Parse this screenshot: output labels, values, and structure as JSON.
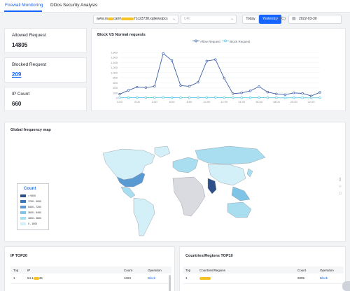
{
  "tabs": [
    {
      "label": "Firewall Monitoring",
      "active": true
    },
    {
      "label": "DDos Security Analysis",
      "active": false
    }
  ],
  "toolbar": {
    "domain_prefix": "www.rs",
    "domain_mid": "cam/",
    "domain_suffix": "71c23738.xgliewsipcs",
    "url_placeholder": "URI",
    "today_label": "Today",
    "yesterday_label": "Yesterday",
    "timezone_label": "(UTC)",
    "date_value": "2022-03-30",
    "colors": {
      "primary": "#1664ff"
    }
  },
  "stats": {
    "allowed_label": "Allowed Request",
    "allowed_value": "14805",
    "blocked_label": "Blocked Request",
    "blocked_value": "209",
    "ip_label": "IP Count",
    "ip_value": "660"
  },
  "chart_data": {
    "type": "line",
    "title": "Block VS Normal requests",
    "x": [
      "0:00",
      "1:00",
      "2:00",
      "3:00",
      "4:00",
      "5:00",
      "6:00",
      "7:00",
      "8:00",
      "9:00",
      "10:00",
      "11:00",
      "12:00",
      "13:00",
      "14:00",
      "15:00",
      "16:00",
      "17:00",
      "18:00",
      "19:00",
      "20:00",
      "21:00",
      "22:00",
      "23:00"
    ],
    "x_tick_labels": [
      "0:00",
      "2:00",
      "4:00",
      "6:00",
      "8:00",
      "10:00",
      "12:00",
      "14:00",
      "16:00",
      "18:00",
      "20:00",
      "22:00"
    ],
    "y_tick_labels": [
      "0",
      "200",
      "400",
      "600",
      "800",
      "1,000",
      "1,200",
      "1,400",
      "1,600",
      "1,800"
    ],
    "ylim": [
      0,
      1800
    ],
    "series": [
      {
        "name": "Allow Request",
        "color": "#3f5fa8",
        "values": [
          150,
          300,
          430,
          410,
          460,
          1760,
          1480,
          490,
          460,
          620,
          1460,
          1520,
          780,
          170,
          200,
          280,
          450,
          230,
          160,
          130,
          200,
          180,
          80,
          220
        ]
      },
      {
        "name": "Block Request",
        "color": "#5ec9e6",
        "values": [
          10,
          12,
          15,
          12,
          18,
          20,
          14,
          10,
          12,
          15,
          18,
          20,
          12,
          8,
          8,
          10,
          12,
          9,
          8,
          6,
          8,
          7,
          6,
          9
        ]
      }
    ],
    "legend_position": "top-center",
    "grid": true
  },
  "map": {
    "title": "Global frequency map",
    "legend_title": "Count",
    "legend_items": [
      {
        "label": "> 9000",
        "color": "#2d4f8a"
      },
      {
        "label": "7200 - 9000",
        "color": "#3a78b8"
      },
      {
        "label": "5400 - 7200",
        "color": "#5a9ad3"
      },
      {
        "label": "3600 - 5400",
        "color": "#7ec4e6"
      },
      {
        "label": "1800 - 3600",
        "color": "#a8def0"
      },
      {
        "label": "0 - 1800",
        "color": "#d3f0f8"
      }
    ]
  },
  "ip_table": {
    "title": "IP TOP20",
    "headers": [
      "Top",
      "IP",
      "Count",
      "Operation"
    ],
    "rows": [
      {
        "top": "1",
        "ip": "54.1",
        "ip_tail": "45",
        "count": "1023",
        "operation": "Block"
      }
    ]
  },
  "country_table": {
    "title": "Countries/Regions TOP10",
    "headers": [
      "Top",
      "Countries/Regions",
      "Count",
      "Operation"
    ],
    "rows": [
      {
        "top": "1",
        "region": "",
        "count": "9095",
        "operation": "Block"
      }
    ]
  }
}
